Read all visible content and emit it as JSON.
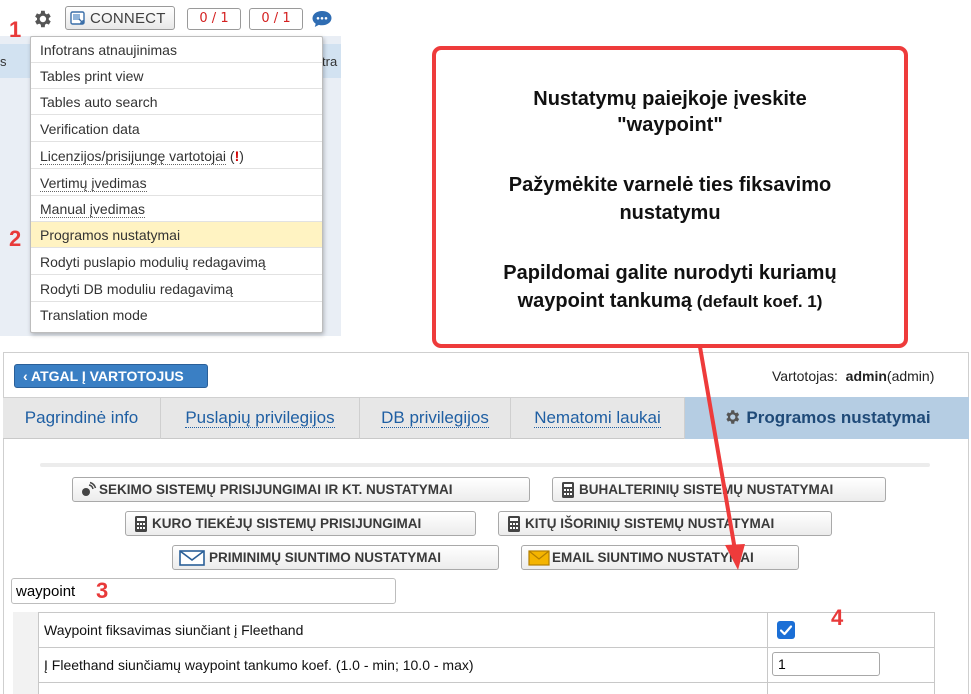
{
  "toolbar": {
    "connect_label": "CONNECT",
    "counter1": "0 / 1",
    "counter2": "0 / 1",
    "background_fragment_left": "s",
    "background_fragment_right": "tra"
  },
  "menu": {
    "items": [
      {
        "label": "Infotrans atnaujinimas"
      },
      {
        "label": "Tables print view"
      },
      {
        "label": "Tables auto search"
      },
      {
        "label": "Verification data"
      },
      {
        "label": "Licenzijos/prisijungę vartotojai",
        "suffix_open": " (",
        "suffix_mark": "!",
        "suffix_close": ")"
      },
      {
        "label": "Vertimų įvedimas"
      },
      {
        "label": "Manual įvedimas"
      },
      {
        "label": "Programos nustatymai"
      },
      {
        "label": "Rodyti puslapio modulių redagavimą"
      },
      {
        "label": "Rodyti DB moduliu redagavimą"
      },
      {
        "label": "Translation mode"
      }
    ],
    "active_index": 7
  },
  "steps": {
    "s1": "1",
    "s2": "2",
    "s3": "3",
    "s4": "4"
  },
  "callout": {
    "line1": "Nustatymų paiejkoje įveskite",
    "line2": "\"waypoint\"",
    "line3": "Pažymėkite varnelė ties fiksavimo",
    "line4": "nustatymu",
    "line5": "Papildomai galite nurodyti kuriamų",
    "line6_main": "waypoint tankumą",
    "line6_small": " (default koef. 1)"
  },
  "page": {
    "back_button": "ATGAL Į VARTOTOJUS",
    "user_label": "Vartotojas:",
    "user_name": "admin",
    "user_role": "(admin)"
  },
  "tabs": [
    {
      "label": "Pagrindinė info"
    },
    {
      "label": "Puslapių privilegijos"
    },
    {
      "label": "DB privilegijos"
    },
    {
      "label": "Nematomi laukai"
    },
    {
      "label": "Programos nustatymai"
    }
  ],
  "settings_buttons": {
    "tracking": "SEKIMO SISTEMŲ PRISIJUNGIMAI IR KT. NUSTATYMAI",
    "accounting": "BUHALTERINIŲ SISTEMŲ NUSTATYMAI",
    "fuel": "KURO TIEKĖJŲ SISTEMŲ PRISIJUNGIMAI",
    "external": "KITŲ IŠORINIŲ SISTEMŲ NUSTATYMAI",
    "reminders": "PRIMINIMŲ SIUNTIMO NUSTATYMAI",
    "email": "EMAIL SIUNTIMO NUSTATYMAI"
  },
  "search": {
    "value": "waypoint"
  },
  "table": {
    "rows": [
      {
        "label": "Waypoint fiksavimas siunčiant į Fleethand",
        "checked": true
      },
      {
        "label": "Į Fleethand siunčiamų waypoint tankumo koef. (1.0 - min; 10.0 - max)",
        "value": "1"
      }
    ]
  },
  "colors": {
    "accent": "#1f5fa3",
    "callout_border": "#ee3b3b",
    "active_tab": "#b5cde3",
    "checkbox": "#1b6fd6"
  }
}
